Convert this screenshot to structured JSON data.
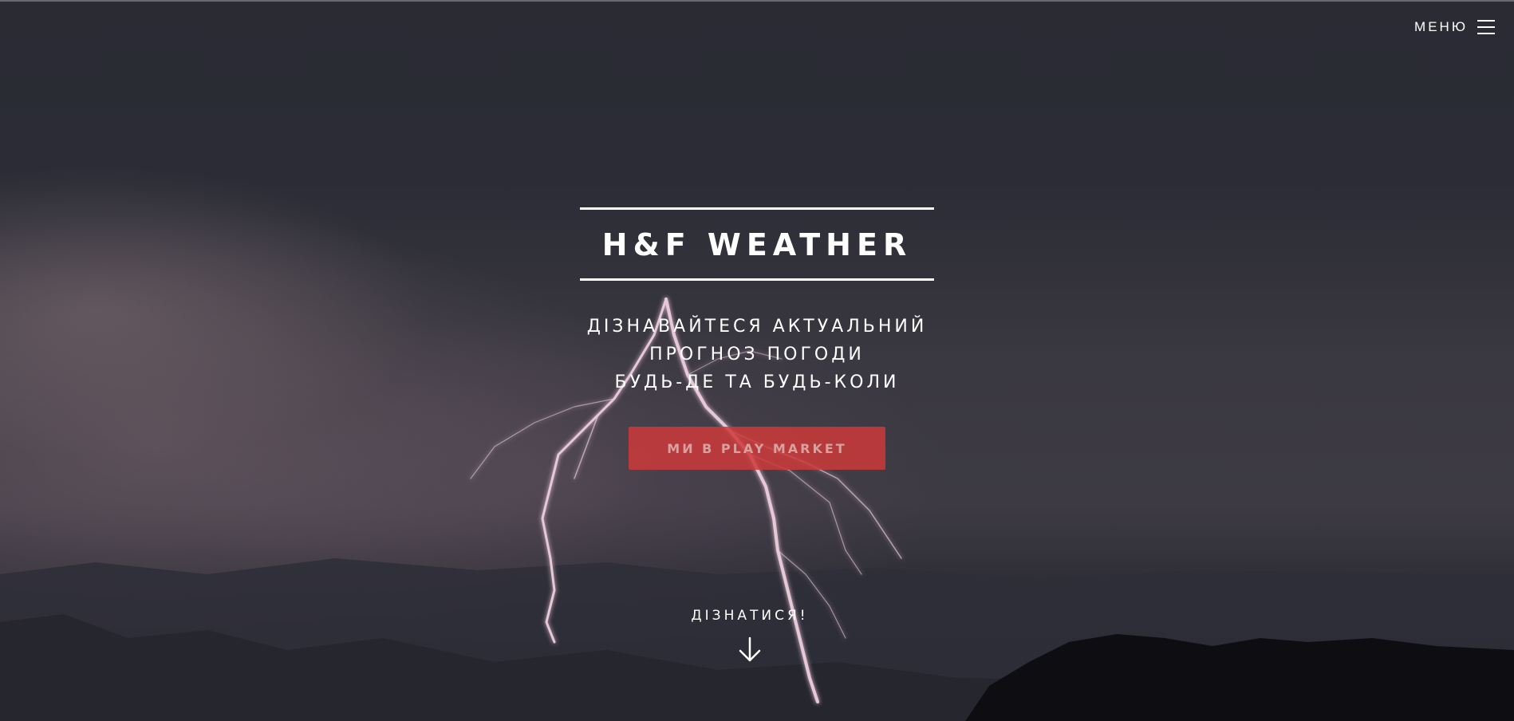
{
  "nav": {
    "menu_label": "МЕНЮ",
    "menu_icon": "hamburger-icon"
  },
  "hero": {
    "title": "H&F WEATHER",
    "subtitle_lines": [
      "ДІЗНАВАЙТЕСЯ АКТУАЛЬНИЙ",
      "ПРОГНОЗ ПОГОДИ",
      "БУДЬ-ДЕ ТА БУДЬ-КОЛИ"
    ],
    "cta_label": "МИ В PLAY MARKET",
    "scroll_label": "ДІЗНАТИСЯ!",
    "scroll_icon": "arrow-down-icon"
  },
  "colors": {
    "background": "#2a2b33",
    "accent": "#cd3a3a",
    "text": "#ffffff"
  }
}
